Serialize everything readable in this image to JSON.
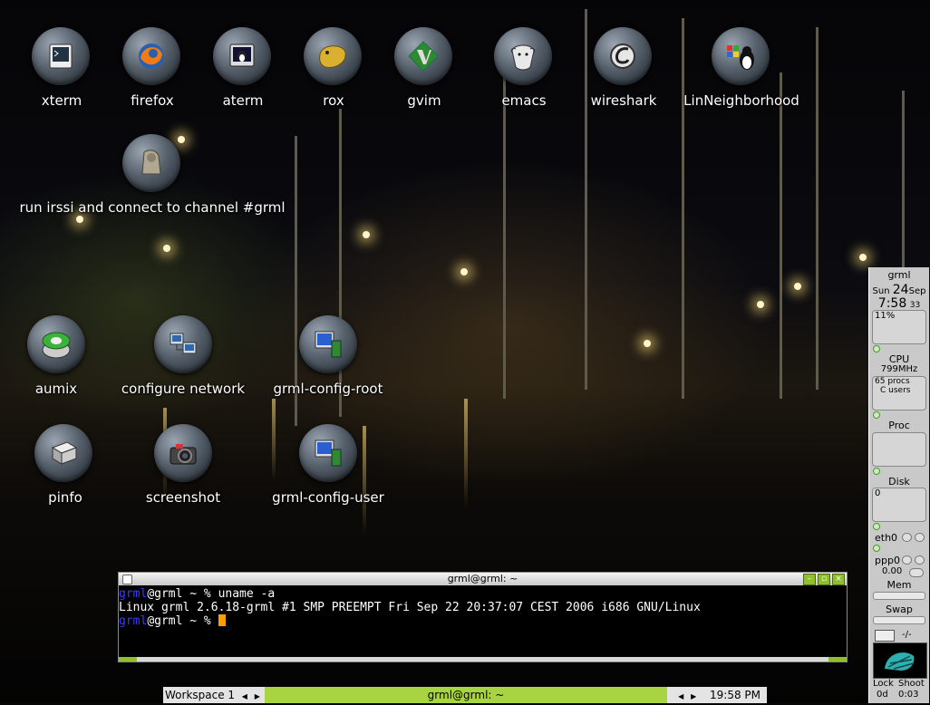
{
  "desktop": {
    "icons": [
      {
        "label": "xterm",
        "glyph": "terminal-icon"
      },
      {
        "label": "firefox",
        "glyph": "firefox-icon"
      },
      {
        "label": "aterm",
        "glyph": "aterm-icon"
      },
      {
        "label": "rox",
        "glyph": "rox-icon"
      },
      {
        "label": "gvim",
        "glyph": "gvim-icon"
      },
      {
        "label": "emacs",
        "glyph": "emacs-icon"
      },
      {
        "label": "wireshark",
        "glyph": "wireshark-icon"
      },
      {
        "label": "LinNeighborhood",
        "glyph": "linneighborhood-icon"
      },
      {
        "label": "run irssi and connect to channel #grml",
        "glyph": "irssi-icon"
      },
      {
        "label": "aumix",
        "glyph": "speaker-icon"
      },
      {
        "label": "configure network",
        "glyph": "network-icon"
      },
      {
        "label": "grml-config-root",
        "glyph": "config-root-icon"
      },
      {
        "label": "pinfo",
        "glyph": "pinfo-icon"
      },
      {
        "label": "screenshot",
        "glyph": "camera-icon"
      },
      {
        "label": "grml-config-user",
        "glyph": "config-user-icon"
      }
    ]
  },
  "terminal": {
    "title": "grml@grml: ~",
    "buttons": [
      "minimize",
      "maximize",
      "close"
    ],
    "line1_user": "grml",
    "line1_rest": "@grml ~ % uname -a",
    "line2": "Linux grml 2.6.18-grml #1 SMP PREEMPT Fri Sep 22 20:37:07 CEST 2006 i686 GNU/Linux",
    "line3_user": "grml",
    "line3_rest": "@grml ~ % "
  },
  "taskbar": {
    "workspace": "Workspace 1",
    "task": "grml@grml: ~",
    "clock": "19:58 PM"
  },
  "dock": {
    "host": "grml",
    "day": "Sun",
    "date": "24",
    "month": "Sep",
    "time": "7:58",
    "seconds": "33",
    "cpu_usage": "11%",
    "cpu_label": "CPU",
    "cpu_freq": "799MHz",
    "procs": "65 procs",
    "users": "C users",
    "proc_label": "Proc",
    "disk_label": "Disk",
    "disk_value": "0",
    "eth": "eth0",
    "ppp": "ppp0",
    "ppp_value": "0.00",
    "mem_label": "Mem",
    "swap_label": "Swap",
    "mail": "-/-",
    "lock_label": "Lock",
    "shoot_label": "Shoot",
    "uptime_days": "0d",
    "uptime_time": "0:03"
  }
}
